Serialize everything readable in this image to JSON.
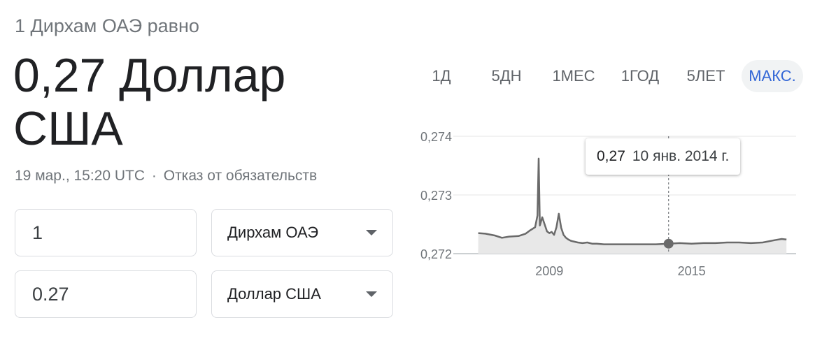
{
  "header": {
    "subtitle": "1 Дирхам ОАЭ равно",
    "result": "0,27 Доллар США",
    "timestamp": "19 мар., 15:20 UTC",
    "separator": "·",
    "disclaimer": "Отказ от обязательств"
  },
  "converter": {
    "from_amount": "1",
    "from_currency": "Дирхам ОАЭ",
    "to_amount": "0.27",
    "to_currency": "Доллар США"
  },
  "range_tabs": [
    {
      "label": "1Д",
      "active": false
    },
    {
      "label": "5ДН",
      "active": false
    },
    {
      "label": "1МЕС",
      "active": false
    },
    {
      "label": "1ГОД",
      "active": false
    },
    {
      "label": "5ЛЕТ",
      "active": false
    },
    {
      "label": "МАКС.",
      "active": true
    }
  ],
  "tooltip": {
    "value": "0,27",
    "date": "10 янв. 2014 г."
  },
  "colors": {
    "accent": "#3367d6",
    "line": "#6a6a6a",
    "fill": "#e8e8e8",
    "grid": "#e6e6e6"
  },
  "chart_data": {
    "type": "area",
    "title": "",
    "xlabel": "",
    "ylabel": "",
    "xlim": [
      2005.6,
      2019.2
    ],
    "ylim": [
      0.272,
      0.274
    ],
    "y_ticks": [
      {
        "value": 0.272,
        "label": "0,272"
      },
      {
        "value": 0.273,
        "label": "0,273"
      },
      {
        "value": 0.274,
        "label": "0,274"
      }
    ],
    "x_ticks": [
      {
        "value": 2009,
        "label": "2009"
      },
      {
        "value": 2015,
        "label": "2015"
      }
    ],
    "grid": true,
    "hover_x": 2014.03,
    "series": [
      {
        "x": [
          2006.0,
          2006.3,
          2006.7,
          2007.0,
          2007.3,
          2007.7,
          2008.0,
          2008.2,
          2008.4,
          2008.5,
          2008.55,
          2008.6,
          2008.7,
          2008.8,
          2008.9,
          2009.0,
          2009.1,
          2009.2,
          2009.3,
          2009.4,
          2009.5,
          2009.6,
          2009.7,
          2009.8,
          2009.9,
          2010.0,
          2010.2,
          2010.4,
          2010.6,
          2010.8,
          2011.0,
          2011.3,
          2011.6,
          2012.0,
          2012.5,
          2013.0,
          2013.5,
          2014.03,
          2014.5,
          2015.0,
          2015.5,
          2016.0,
          2016.5,
          2017.0,
          2017.5,
          2018.0,
          2018.5,
          2018.8,
          2019.0
        ],
        "y": [
          0.27235,
          0.27234,
          0.27231,
          0.27227,
          0.27229,
          0.2723,
          0.27234,
          0.2724,
          0.27245,
          0.27265,
          0.27362,
          0.27248,
          0.27262,
          0.2725,
          0.27238,
          0.27235,
          0.27237,
          0.27232,
          0.27245,
          0.27268,
          0.27244,
          0.27232,
          0.27227,
          0.27224,
          0.27222,
          0.27221,
          0.27219,
          0.27218,
          0.27219,
          0.27217,
          0.27217,
          0.27216,
          0.27216,
          0.27216,
          0.27216,
          0.27216,
          0.27216,
          0.27217,
          0.27218,
          0.27217,
          0.27218,
          0.27218,
          0.27219,
          0.27219,
          0.27218,
          0.27219,
          0.27223,
          0.27225,
          0.27224
        ]
      }
    ]
  }
}
